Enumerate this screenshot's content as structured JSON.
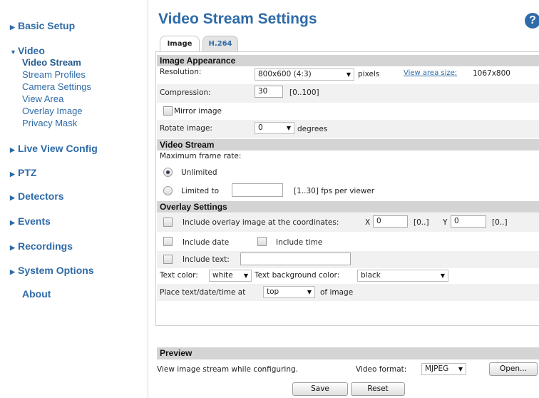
{
  "sidebar": {
    "items": [
      {
        "label": "Basic Setup"
      },
      {
        "label": "Video",
        "subitems": [
          "Video Stream",
          "Stream Profiles",
          "Camera Settings",
          "View Area",
          "Overlay Image",
          "Privacy Mask"
        ]
      },
      {
        "label": "Live View Config"
      },
      {
        "label": "PTZ"
      },
      {
        "label": "Detectors"
      },
      {
        "label": "Events"
      },
      {
        "label": "Recordings"
      },
      {
        "label": "System Options"
      },
      {
        "label": "About"
      }
    ],
    "active_subitem": "Video Stream"
  },
  "header": {
    "title": "Video Stream Settings",
    "help_glyph": "?"
  },
  "tabs": [
    {
      "label": "Image",
      "active": true
    },
    {
      "label": "H.264",
      "active": false
    }
  ],
  "image_appearance": {
    "title": "Image Appearance",
    "resolution_label": "Resolution:",
    "resolution_value": "800x600 (4:3)",
    "resolution_unit": "pixels",
    "view_area_link": "View area size:",
    "view_area_value": "1067x800",
    "compression_label": "Compression:",
    "compression_value": "30",
    "compression_range": "[0..100]",
    "mirror_label": "Mirror image",
    "rotate_label": "Rotate image:",
    "rotate_value": "0",
    "rotate_unit": "degrees"
  },
  "video_stream": {
    "title": "Video Stream",
    "max_frame_rate_label": "Maximum frame rate:",
    "unlimited_label": "Unlimited",
    "limited_label": "Limited to",
    "limited_value": "",
    "limited_range": "[1..30] fps per viewer"
  },
  "overlay_settings": {
    "title": "Overlay Settings",
    "include_overlay_label": "Include overlay image at the coordinates:",
    "x_label": "X",
    "x_value": "0",
    "x_range": "[0..]",
    "y_label": "Y",
    "y_value": "0",
    "y_range": "[0..]",
    "include_date_label": "Include date",
    "include_time_label": "Include time",
    "include_text_label": "Include text:",
    "include_text_value": "",
    "text_color_label": "Text color:",
    "text_color_value": "white",
    "text_bg_label": "Text background color:",
    "text_bg_value": "black",
    "place_label": "Place text/date/time at",
    "place_value": "top",
    "place_suffix": "of image"
  },
  "preview": {
    "title": "Preview",
    "description": "View image stream while configuring.",
    "format_label": "Video format:",
    "format_value": "MJPEG",
    "open_button": "Open..."
  },
  "footer": {
    "save_button": "Save",
    "reset_button": "Reset"
  },
  "colors": {
    "accent": "#2e6ba8",
    "section_header_bg": "#d4d4d4",
    "row_shade": "#f1f1f1"
  }
}
